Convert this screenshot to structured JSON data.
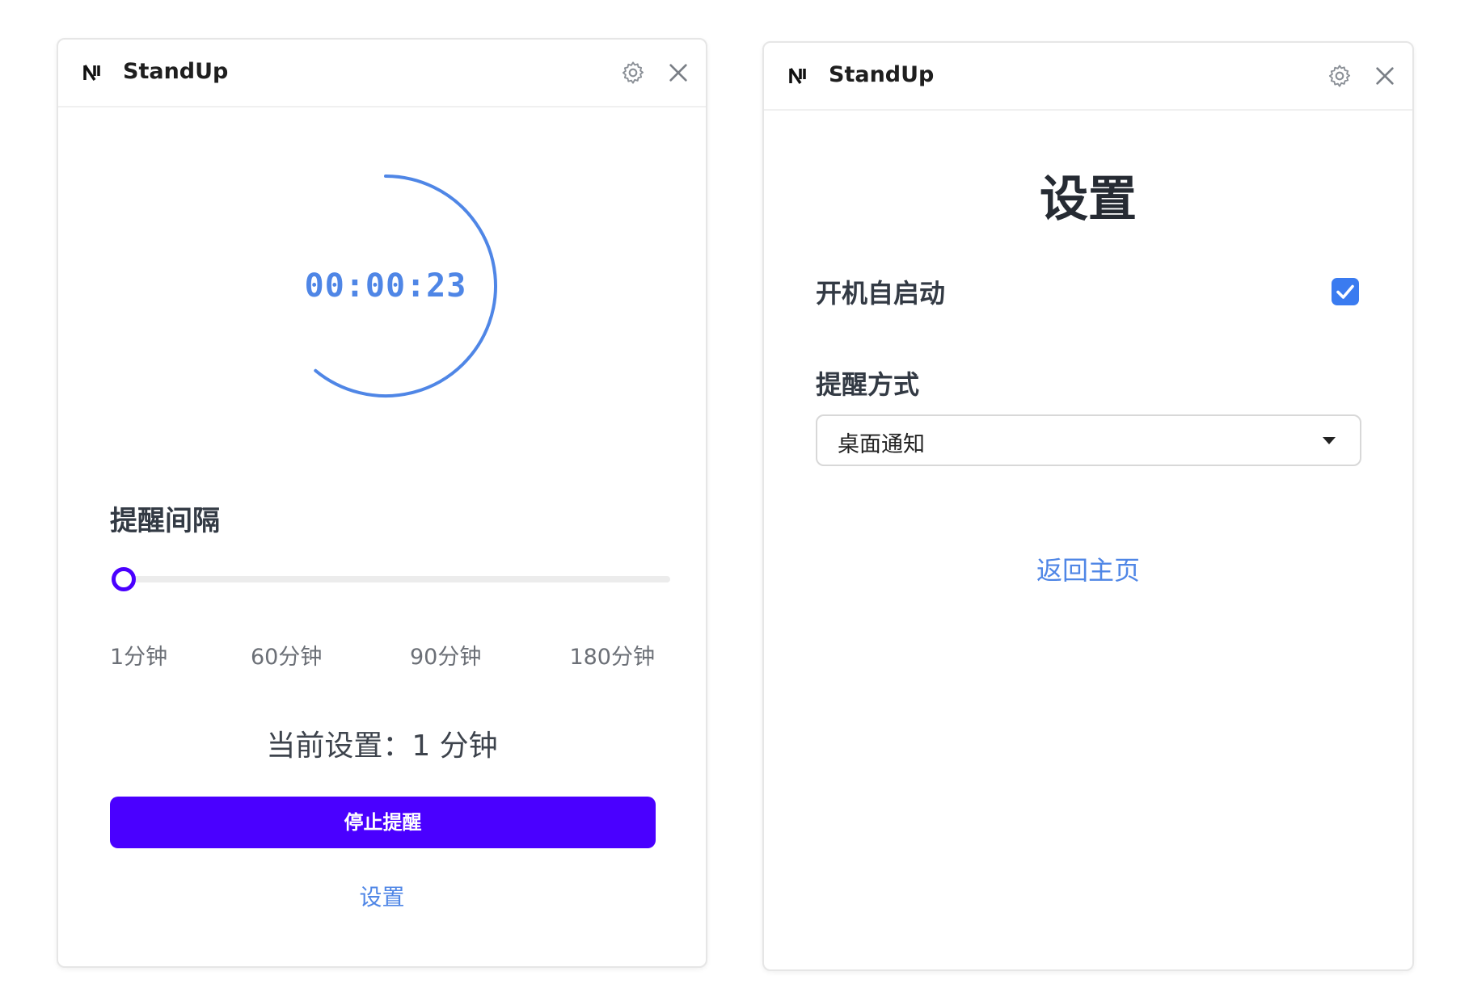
{
  "colors": {
    "accent_blue": "#4f86e6",
    "primary_button": "#4a00ff",
    "checkbox_blue": "#3a7bf0"
  },
  "left_window": {
    "app_title": "StandUp",
    "icons": {
      "logo": "standup-logo-icon",
      "settings": "gear-icon",
      "close": "close-icon"
    },
    "timer": {
      "display": "00:00:23",
      "progress": 0.61
    },
    "interval_label": "提醒间隔",
    "slider": {
      "value": 1,
      "ticks": [
        "1分钟",
        "60分钟",
        "90分钟",
        "180分钟"
      ]
    },
    "current_setting": "当前设置：1 分钟",
    "stop_button": "停止提醒",
    "settings_link": "设置"
  },
  "right_window": {
    "app_title": "StandUp",
    "icons": {
      "logo": "standup-logo-icon",
      "settings": "gear-icon",
      "close": "close-icon"
    },
    "page_title": "设置",
    "autostart_label": "开机自启动",
    "autostart_checked": true,
    "reminder_method_label": "提醒方式",
    "reminder_method_value": "桌面通知",
    "home_link": "返回主页"
  }
}
